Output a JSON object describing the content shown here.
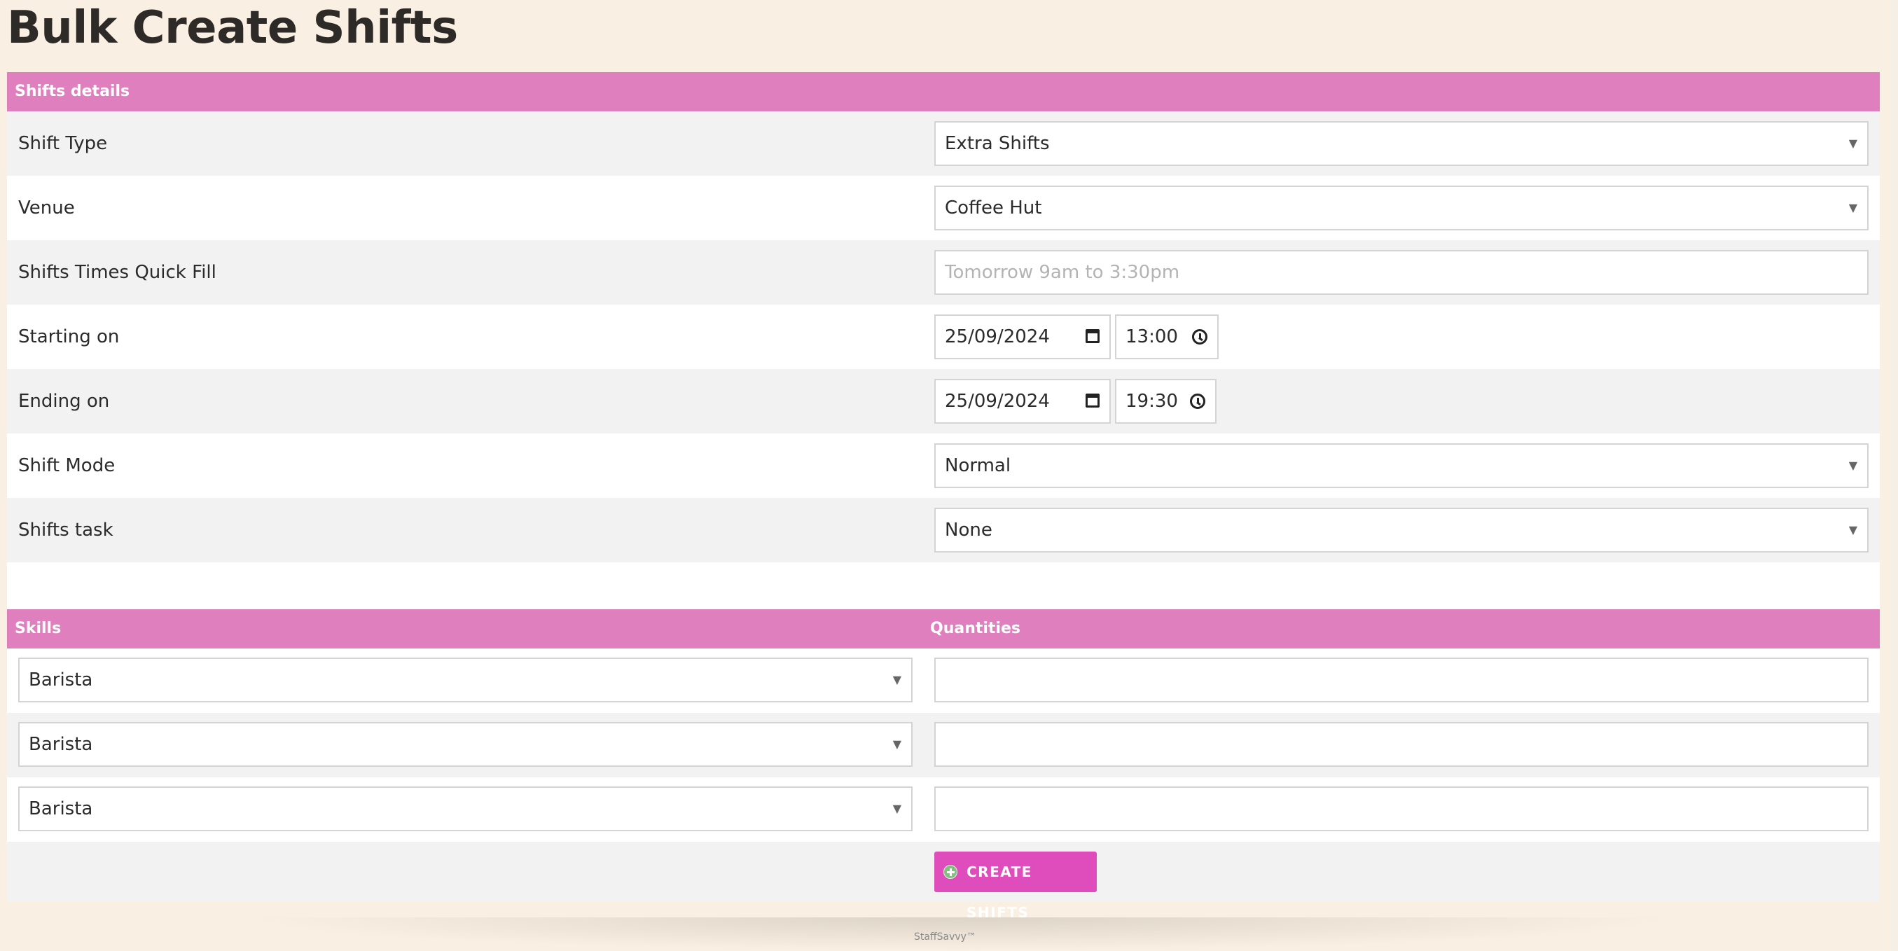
{
  "page": {
    "title": "Bulk Create Shifts"
  },
  "shift_details": {
    "header": "Shifts details",
    "shift_type": {
      "label": "Shift Type",
      "value": "Extra Shifts"
    },
    "venue": {
      "label": "Venue",
      "value": "Coffee Hut"
    },
    "quick_fill": {
      "label": "Shifts Times Quick Fill",
      "placeholder": "Tomorrow 9am to 3:30pm"
    },
    "starting_on": {
      "label": "Starting on",
      "date": "25/09/2024",
      "time": "13:00"
    },
    "ending_on": {
      "label": "Ending on",
      "date": "25/09/2024",
      "time": "19:30"
    },
    "shift_mode": {
      "label": "Shift Mode",
      "value": "Normal"
    },
    "shifts_task": {
      "label": "Shifts task",
      "value": "None"
    }
  },
  "skills_section": {
    "skills_header": "Skills",
    "quantities_header": "Quantities",
    "rows": [
      {
        "skill": "Barista",
        "quantity": ""
      },
      {
        "skill": "Barista",
        "quantity": ""
      },
      {
        "skill": "Barista",
        "quantity": ""
      }
    ]
  },
  "actions": {
    "create_label": "CREATE SHIFTS"
  },
  "footer": {
    "brand": "StaffSavvy™"
  },
  "colors": {
    "header_pink": "#e07fbd",
    "button_pink": "#df4cbc",
    "background": "#f9f0e3"
  }
}
